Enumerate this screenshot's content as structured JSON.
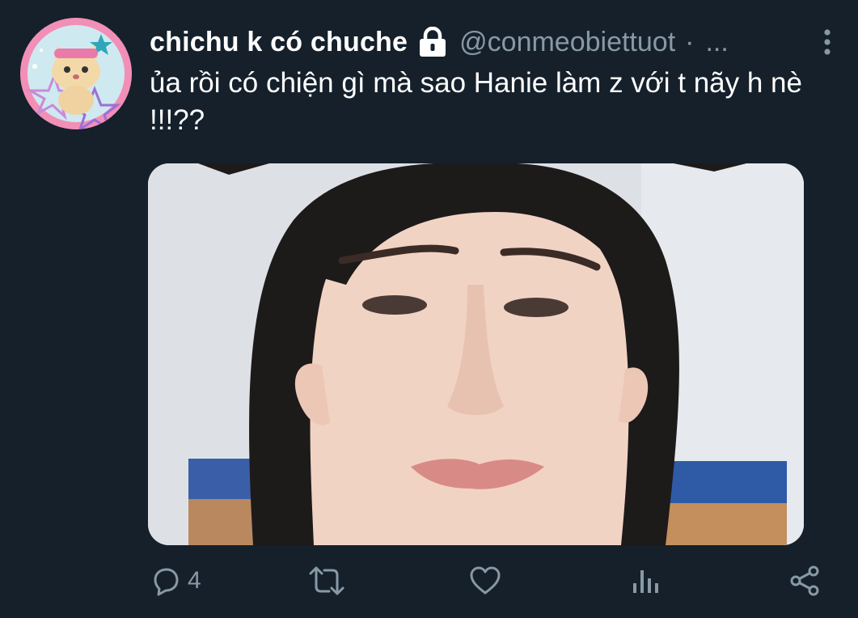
{
  "tweet": {
    "display_name": "chichu k có chuche",
    "handle": "@conmeobiettuot",
    "separator": "·",
    "timestamp": "...",
    "text": "ủa rồi có chiện gì mà sao Hanie làm z với t nãy h nè !!!??",
    "protected": true
  },
  "actions": {
    "reply_count": "4"
  },
  "icons": {
    "lock": "lock-icon",
    "more": "more-vertical-icon",
    "reply": "reply-icon",
    "retweet": "retweet-icon",
    "like": "heart-icon",
    "analytics": "analytics-icon",
    "share": "share-icon"
  },
  "colors": {
    "background": "#15202b",
    "primary_text": "#ffffff",
    "secondary_text": "#8899a6",
    "avatar_ring": "#f28fb7"
  }
}
